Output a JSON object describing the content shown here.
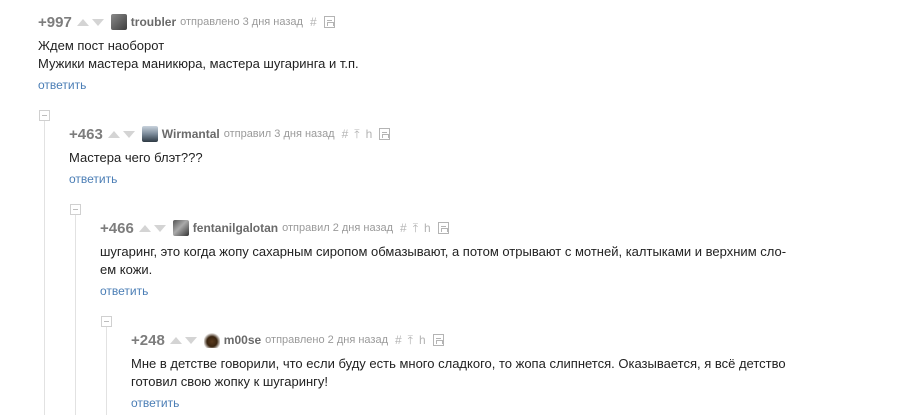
{
  "comments": [
    {
      "rating": "+997",
      "author": "troubler",
      "meta": "отправлено 3 дня назад",
      "lines": [
        "Ждем пост наоборот",
        "Мужики мастера маникюра, мастера шугаринга и т.п."
      ],
      "reply": "ответить"
    },
    {
      "rating": "+463",
      "author": "Wirmantal",
      "meta": "отправил 3 дня назад",
      "lines": [
        "Мастера чего блэт???"
      ],
      "reply": "ответить"
    },
    {
      "rating": "+466",
      "author": "fentanilgalotan",
      "meta": "отправил 2 дня назад",
      "lines": [
        "шугаринг, это когда жопу сахарным сиропом обмазывают, а потом отрывают с мотней, калтыками и верхним сло-",
        "ем кожи."
      ],
      "reply": "ответить"
    },
    {
      "rating": "+248",
      "author": "m00se",
      "meta": "отправлено 2 дня назад",
      "lines": [
        "Мне в детстве говорили, что если буду есть много сладкого, то жопа слипнется. Оказывается, я всё детство",
        "готовил свою жопку к шугарингу!"
      ],
      "reply": "ответить"
    }
  ],
  "icons": {
    "link": "#",
    "parent": "⤒",
    "thread": "h",
    "save": "save-icon"
  },
  "colors": {
    "rating": "#7d7d7d",
    "link": "#4a7db5",
    "author": "#6a6a6a"
  }
}
